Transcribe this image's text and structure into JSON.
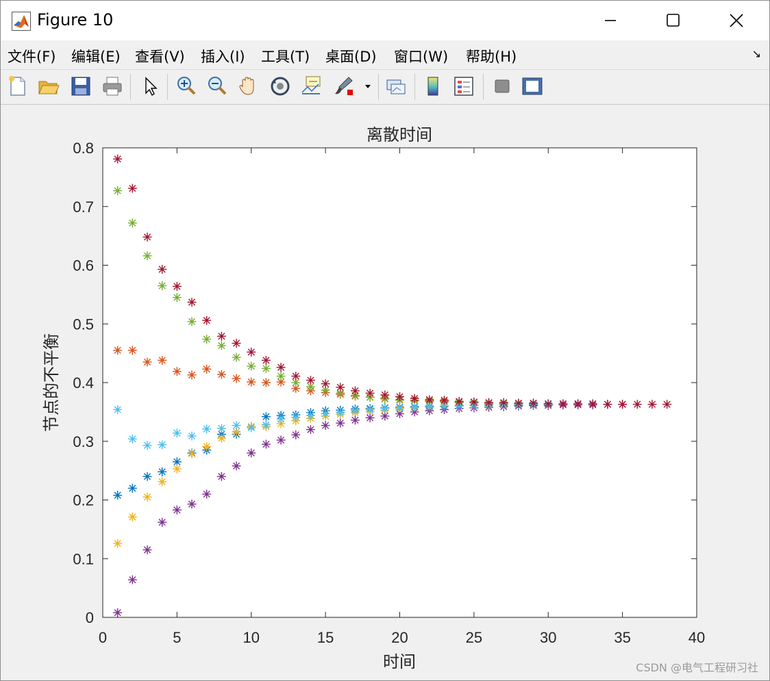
{
  "window": {
    "title": "Figure 10",
    "icon": "matlab-icon",
    "controls": {
      "minimize": "minimize-icon",
      "maximize": "maximize-icon",
      "close": "close-icon"
    }
  },
  "menu": [
    "文件(F)",
    "编辑(E)",
    "查看(V)",
    "插入(I)",
    "工具(T)",
    "桌面(D)",
    "窗口(W)",
    "帮助(H)"
  ],
  "menu_corner": "↘",
  "toolbar": [
    "new-figure-icon",
    "open-file-icon",
    "save-icon",
    "print-icon",
    "select-arrow-icon",
    "zoom-in-icon",
    "zoom-out-icon",
    "pan-hand-icon",
    "rotate-3d-icon",
    "data-cursor-icon",
    "brush-icon",
    "brush-dropdown-icon",
    "link-plot-icon",
    "insert-colorbar-icon",
    "insert-legend-icon",
    "hide-plot-tools-icon",
    "show-plot-tools-icon"
  ],
  "chart_data": {
    "type": "scatter",
    "title": "离散时间",
    "xlabel": "时间",
    "ylabel": "节点的不平衡",
    "xlim": [
      0,
      40
    ],
    "ylim": [
      0,
      0.8
    ],
    "xticks": [
      "0",
      "5",
      "10",
      "15",
      "20",
      "25",
      "30",
      "35",
      "40"
    ],
    "yticks": [
      "0",
      "0.1",
      "0.2",
      "0.3",
      "0.4",
      "0.5",
      "0.6",
      "0.7",
      "0.8"
    ],
    "marker": "*",
    "grid": false,
    "box": true,
    "series": [
      {
        "color": "#0072BD",
        "x": [
          1,
          2,
          3,
          4,
          5,
          6,
          7,
          8,
          9,
          10,
          11,
          12,
          13,
          14,
          15,
          16,
          17,
          18,
          19,
          20,
          21,
          22,
          23,
          24,
          25,
          26,
          27,
          28,
          29,
          30
        ],
        "y": [
          0.208,
          0.22,
          0.24,
          0.248,
          0.265,
          0.28,
          0.285,
          0.312,
          0.312,
          0.325,
          0.342,
          0.344,
          0.345,
          0.349,
          0.352,
          0.353,
          0.355,
          0.356,
          0.357,
          0.358,
          0.359,
          0.36,
          0.36,
          0.361,
          0.361,
          0.362,
          0.362,
          0.362,
          0.362,
          0.363
        ]
      },
      {
        "color": "#D95319",
        "x": [
          1,
          2,
          3,
          4,
          5,
          6,
          7,
          8,
          9,
          10,
          11,
          12,
          13,
          14,
          15,
          16,
          17,
          18,
          19,
          20,
          21,
          22,
          23,
          24,
          25,
          26,
          27,
          28,
          29,
          30
        ],
        "y": [
          0.455,
          0.455,
          0.435,
          0.438,
          0.419,
          0.413,
          0.423,
          0.414,
          0.407,
          0.401,
          0.4,
          0.401,
          0.39,
          0.386,
          0.383,
          0.38,
          0.377,
          0.375,
          0.373,
          0.371,
          0.37,
          0.369,
          0.368,
          0.367,
          0.366,
          0.365,
          0.365,
          0.364,
          0.364,
          0.363
        ]
      },
      {
        "color": "#EDB120",
        "x": [
          1,
          2,
          3,
          4,
          5,
          6,
          7,
          8,
          9,
          10,
          11,
          12,
          13,
          14,
          15,
          16,
          17,
          18,
          19,
          20,
          21,
          22,
          23,
          24,
          25,
          26,
          27,
          28,
          29,
          30
        ],
        "y": [
          0.126,
          0.171,
          0.205,
          0.231,
          0.253,
          0.279,
          0.291,
          0.305,
          0.316,
          0.325,
          0.325,
          0.33,
          0.335,
          0.339,
          0.343,
          0.346,
          0.349,
          0.351,
          0.353,
          0.355,
          0.357,
          0.358,
          0.359,
          0.36,
          0.361,
          0.361,
          0.362,
          0.362,
          0.363,
          0.363
        ]
      },
      {
        "color": "#7E2F8E",
        "x": [
          1,
          2,
          3,
          4,
          5,
          6,
          7,
          8,
          9,
          10,
          11,
          12,
          13,
          14,
          15,
          16,
          17,
          18,
          19,
          20,
          21,
          22,
          23,
          24,
          25,
          26,
          27,
          28,
          29,
          30,
          31,
          32,
          33,
          34,
          35
        ],
        "y": [
          0.008,
          0.064,
          0.115,
          0.162,
          0.183,
          0.193,
          0.21,
          0.24,
          0.258,
          0.28,
          0.295,
          0.302,
          0.311,
          0.32,
          0.327,
          0.331,
          0.336,
          0.34,
          0.343,
          0.347,
          0.35,
          0.352,
          0.354,
          0.356,
          0.357,
          0.358,
          0.359,
          0.36,
          0.361,
          0.361,
          0.362,
          0.362,
          0.362,
          0.363,
          0.363
        ]
      },
      {
        "color": "#77AC30",
        "x": [
          1,
          2,
          3,
          4,
          5,
          6,
          7,
          8,
          9,
          10,
          11,
          12,
          13,
          14,
          15,
          16,
          17,
          18,
          19,
          20,
          21,
          22,
          23,
          24,
          25,
          26,
          27,
          28,
          29,
          30
        ],
        "y": [
          0.727,
          0.672,
          0.616,
          0.565,
          0.545,
          0.504,
          0.474,
          0.463,
          0.443,
          0.428,
          0.424,
          0.411,
          0.4,
          0.393,
          0.387,
          0.382,
          0.378,
          0.375,
          0.372,
          0.37,
          0.369,
          0.368,
          0.367,
          0.366,
          0.365,
          0.364,
          0.364,
          0.364,
          0.363,
          0.363
        ]
      },
      {
        "color": "#4DBEEE",
        "x": [
          1,
          2,
          3,
          4,
          5,
          6,
          7,
          8,
          9,
          10,
          11,
          12,
          13,
          14,
          15,
          16,
          17,
          18,
          19,
          20,
          21,
          22,
          23,
          24,
          25,
          26,
          27,
          28,
          29,
          30
        ],
        "y": [
          0.354,
          0.304,
          0.293,
          0.294,
          0.314,
          0.309,
          0.321,
          0.322,
          0.327,
          0.323,
          0.328,
          0.338,
          0.341,
          0.344,
          0.347,
          0.349,
          0.352,
          0.354,
          0.356,
          0.357,
          0.358,
          0.359,
          0.36,
          0.36,
          0.361,
          0.362,
          0.362,
          0.362,
          0.363,
          0.363
        ]
      },
      {
        "color": "#A2142F",
        "x": [
          1,
          2,
          3,
          4,
          5,
          6,
          7,
          8,
          9,
          10,
          11,
          12,
          13,
          14,
          15,
          16,
          17,
          18,
          19,
          20,
          21,
          22,
          23,
          24,
          25,
          26,
          27,
          28,
          29,
          30,
          31,
          32,
          33,
          34,
          35,
          36,
          37,
          38
        ],
        "y": [
          0.781,
          0.731,
          0.648,
          0.593,
          0.564,
          0.537,
          0.506,
          0.479,
          0.467,
          0.452,
          0.438,
          0.426,
          0.411,
          0.404,
          0.398,
          0.392,
          0.386,
          0.382,
          0.379,
          0.376,
          0.373,
          0.371,
          0.37,
          0.368,
          0.367,
          0.366,
          0.366,
          0.365,
          0.365,
          0.364,
          0.364,
          0.364,
          0.364,
          0.363,
          0.363,
          0.363,
          0.363,
          0.363
        ]
      }
    ]
  },
  "watermark": "CSDN @电气工程研习社"
}
